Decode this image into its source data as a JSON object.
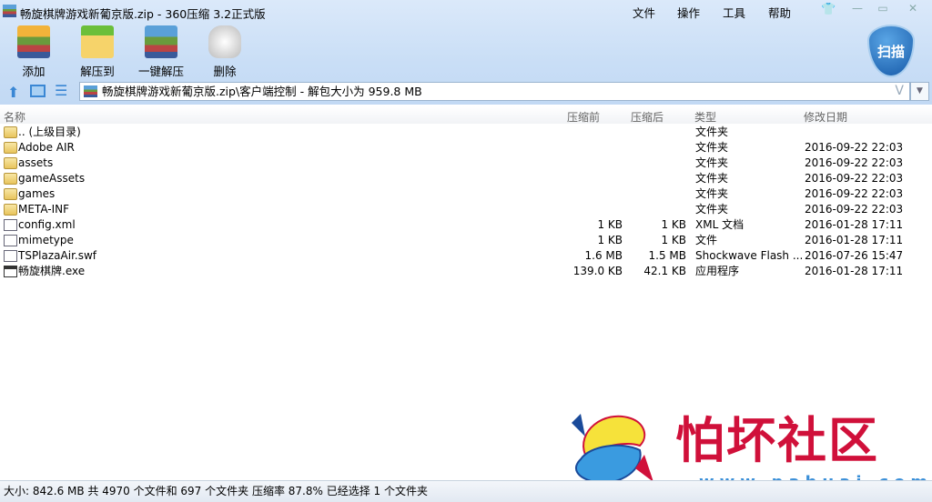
{
  "window": {
    "title": "畅旋棋牌游戏新葡京版.zip - 360压缩 3.2正式版"
  },
  "menu": [
    "文件",
    "操作",
    "工具",
    "帮助"
  ],
  "toolbar": [
    {
      "label": "添加",
      "icon": "add-archive-icon"
    },
    {
      "label": "解压到",
      "icon": "extract-to-icon"
    },
    {
      "label": "一键解压",
      "icon": "one-click-extract-icon"
    },
    {
      "label": "删除",
      "icon": "delete-icon"
    }
  ],
  "scan_label": "扫描",
  "address": {
    "path": "畅旋棋牌游戏新葡京版.zip\\客户端控制 - 解包大小为 959.8 MB",
    "v": "V"
  },
  "columns": [
    "名称",
    "压缩前",
    "压缩后",
    "类型",
    "修改日期"
  ],
  "files": [
    {
      "name": ".. (上级目录)",
      "before": "",
      "after": "",
      "type": "文件夹",
      "date": "",
      "icon": "folder"
    },
    {
      "name": "Adobe AIR",
      "before": "",
      "after": "",
      "type": "文件夹",
      "date": "2016-09-22 22:03",
      "icon": "folder"
    },
    {
      "name": "assets",
      "before": "",
      "after": "",
      "type": "文件夹",
      "date": "2016-09-22 22:03",
      "icon": "folder"
    },
    {
      "name": "gameAssets",
      "before": "",
      "after": "",
      "type": "文件夹",
      "date": "2016-09-22 22:03",
      "icon": "folder"
    },
    {
      "name": "games",
      "before": "",
      "after": "",
      "type": "文件夹",
      "date": "2016-09-22 22:03",
      "icon": "folder"
    },
    {
      "name": "META-INF",
      "before": "",
      "after": "",
      "type": "文件夹",
      "date": "2016-09-22 22:03",
      "icon": "folder"
    },
    {
      "name": "config.xml",
      "before": "1 KB",
      "after": "1 KB",
      "type": "XML 文档",
      "date": "2016-01-28 17:11",
      "icon": "doc"
    },
    {
      "name": "mimetype",
      "before": "1 KB",
      "after": "1 KB",
      "type": "文件",
      "date": "2016-01-28 17:11",
      "icon": "doc"
    },
    {
      "name": "TSPlazaAir.swf",
      "before": "1.6 MB",
      "after": "1.5 MB",
      "type": "Shockwave Flash ...",
      "date": "2016-07-26 15:47",
      "icon": "doc"
    },
    {
      "name": "畅旋棋牌.exe",
      "before": "139.0 KB",
      "after": "42.1 KB",
      "type": "应用程序",
      "date": "2016-01-28 17:11",
      "icon": "exe"
    }
  ],
  "status": "大小: 842.6 MB 共 4970 个文件和 697 个文件夹 压缩率 87.8% 已经选择 1 个文件夹",
  "watermark": {
    "brand": "怕坏社区",
    "url": "www.pahuai.com"
  }
}
